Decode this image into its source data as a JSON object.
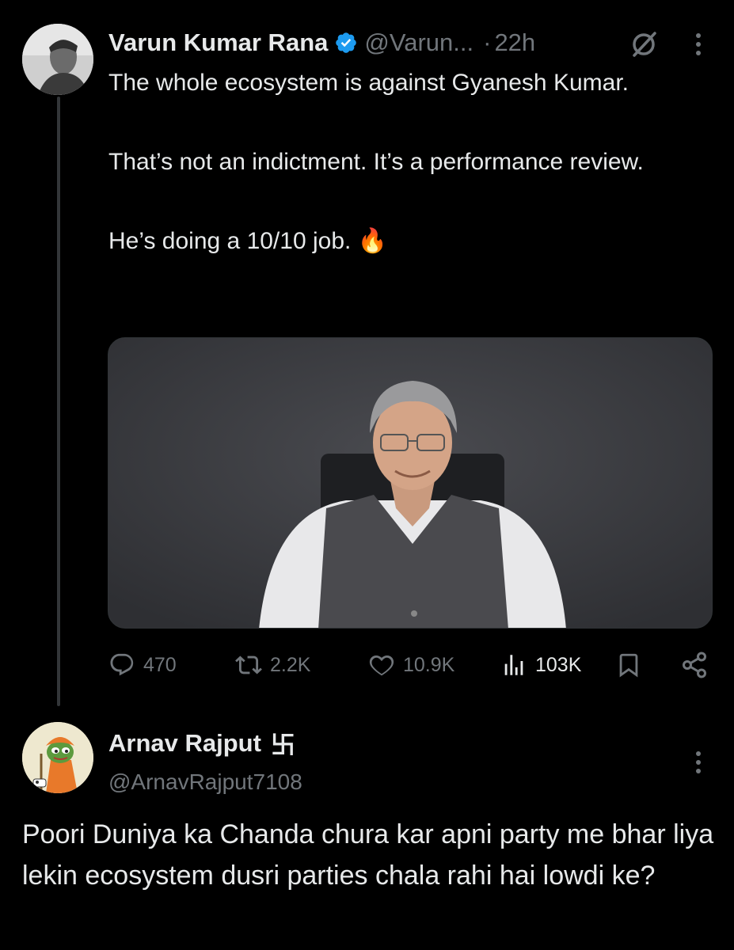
{
  "tweet": {
    "author_name": "Varun Kumar Rana",
    "handle": "@Varun...",
    "separator": "·",
    "time": "22h",
    "paragraphs": [
      "The whole ecosystem is against Gyanesh Kumar.",
      "That’s not an indictment. It’s a performance review.",
      "He’s doing a 10/10 job. 🔥"
    ],
    "stats": {
      "replies": "470",
      "reposts": "2.2K",
      "likes": "10.9K",
      "views": "103K"
    }
  },
  "reply": {
    "author_name": "Arnav Rajput",
    "badge": "卐",
    "handle": "@ArnavRajput7108",
    "text": "Poori Duniya ka Chanda chura kar apni party me bhar liya lekin ecosystem dusri parties chala rahi hai lowdi ke?"
  },
  "colors": {
    "background": "#000000",
    "text": "#e7e9ea",
    "muted": "#71767b",
    "verified": "#1d9bf0",
    "thread_line": "#333639"
  },
  "icons": {
    "verified": "verified-badge-icon",
    "grok": "grok-icon",
    "more": "more-dots-icon",
    "reply": "reply-icon",
    "repost": "repost-icon",
    "like": "heart-icon",
    "views": "views-icon",
    "bookmark": "bookmark-icon",
    "share": "share-icon"
  }
}
